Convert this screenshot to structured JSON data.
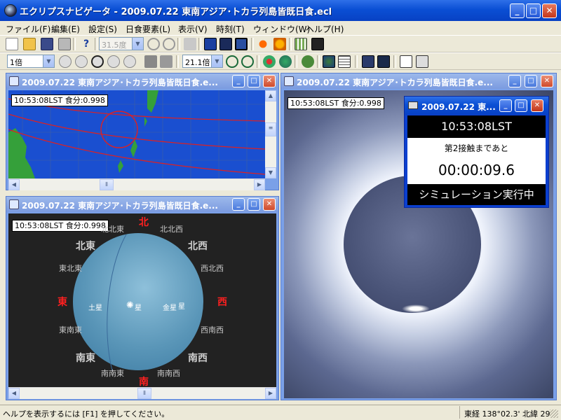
{
  "app": {
    "title": "エクリプスナビゲータ - 2009.07.22 東南アジア･トカラ列島皆既日食.ecl",
    "min": "_",
    "max": "□",
    "close": "✕"
  },
  "menu": [
    "ファイル(F)",
    "編集(E)",
    "設定(S)",
    "日食要素(L)",
    "表示(V)",
    "時刻(T)",
    "ウィンドウ(W)",
    "ヘルプ(H)"
  ],
  "toolbar1": {
    "zoom_value": "31.5度"
  },
  "toolbar2": {
    "speed_value": "1倍",
    "zoom2_value": "21.1倍"
  },
  "windows": {
    "map": {
      "title": "2009.07.22 東南アジア･トカラ列島皆既日食.e...",
      "info": "10:53:08LST 食分:0.998"
    },
    "sky": {
      "title": "2009.07.22 東南アジア･トカラ列島皆既日食.e...",
      "info": "10:53:08LST 食分:0.998"
    },
    "sun": {
      "title": "2009.07.22 東南アジア･トカラ列島皆既日食.e...",
      "info": "10:53:08LST 食分:0.998"
    },
    "progress": {
      "title": "2009.07.22 東...",
      "time": "10:53:08LST",
      "event": "第2接触まであと",
      "countdown": "00:00:09.6",
      "status": "シミュレーション実行中"
    }
  },
  "sky_labels": {
    "n": "北",
    "nnw": "北北西",
    "nw": "北西",
    "wnw": "西北西",
    "w": "西",
    "wsw": "西南西",
    "sw": "南西",
    "ssw": "南南西",
    "s": "南",
    "sse": "南南東",
    "se": "南東",
    "ese": "東南東",
    "e": "東",
    "ene": "東北東",
    "ne": "北東",
    "nne": "北北東"
  },
  "planets": {
    "saturn": "土星",
    "jupiter_area": "星",
    "venus": "金星",
    "mercury": "星"
  },
  "status": {
    "help": "ヘルプを表示するには [F1] を押してください。",
    "coords": "東経 138°02.3' 北緯 29"
  },
  "colors": {
    "map_sea": "#1a4fd0",
    "map_land": "#35a03a",
    "sky_bg": "#222222",
    "sun_bg": "#3a4260"
  }
}
